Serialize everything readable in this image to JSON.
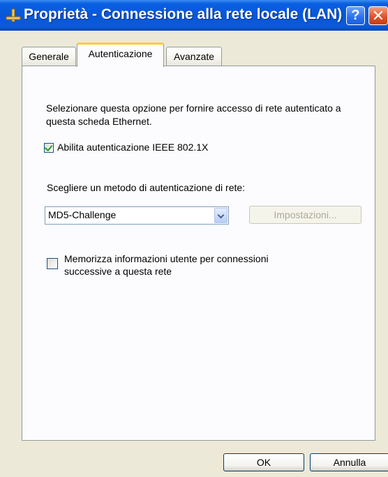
{
  "window": {
    "title": "Proprietà - Connessione alla rete locale (LAN)",
    "help_glyph": "?",
    "close_glyph": "✕"
  },
  "tabs": [
    {
      "label": "Generale"
    },
    {
      "label": "Autenticazione"
    },
    {
      "label": "Avanzate"
    }
  ],
  "active_tab": "Autenticazione",
  "auth": {
    "description": "Selezionare questa opzione per fornire accesso di rete autenticato a questa scheda Ethernet.",
    "enable_label": "Abilita autenticazione IEEE 802.1X",
    "enable_checked": true,
    "method_label": "Scegliere un metodo di autenticazione di rete:",
    "method_value": "MD5-Challenge",
    "settings_button": "Impostazioni...",
    "remember_label": "Memorizza informazioni utente per connessioni successive a questa rete",
    "remember_checked": false
  },
  "footer": {
    "ok": "OK",
    "cancel": "Annulla"
  },
  "icons": {
    "title": "network-connection-icon",
    "dropdown": "chevron-down-icon"
  }
}
